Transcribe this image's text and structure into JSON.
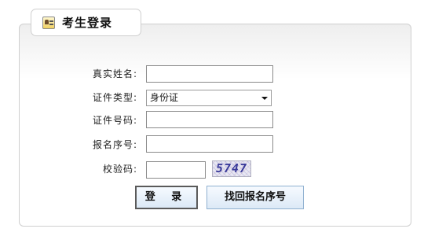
{
  "header": {
    "title": "考生登录",
    "icon": "id-card-icon"
  },
  "form": {
    "name_label": "真实姓名:",
    "name_value": "",
    "id_type_label": "证件类型:",
    "id_type_selected": "身份证",
    "id_number_label": "证件号码:",
    "id_number_value": "",
    "reg_number_label": "报名序号:",
    "reg_number_value": "",
    "captcha_label": "校验码:",
    "captcha_value": "",
    "captcha_image_text": "5747"
  },
  "buttons": {
    "login_label": "登 录",
    "retrieve_label": "找回报名序号"
  },
  "colors": {
    "border": "#cfcfcf",
    "button_border": "#8fb0d0",
    "captcha_text": "#3a3a9a"
  }
}
